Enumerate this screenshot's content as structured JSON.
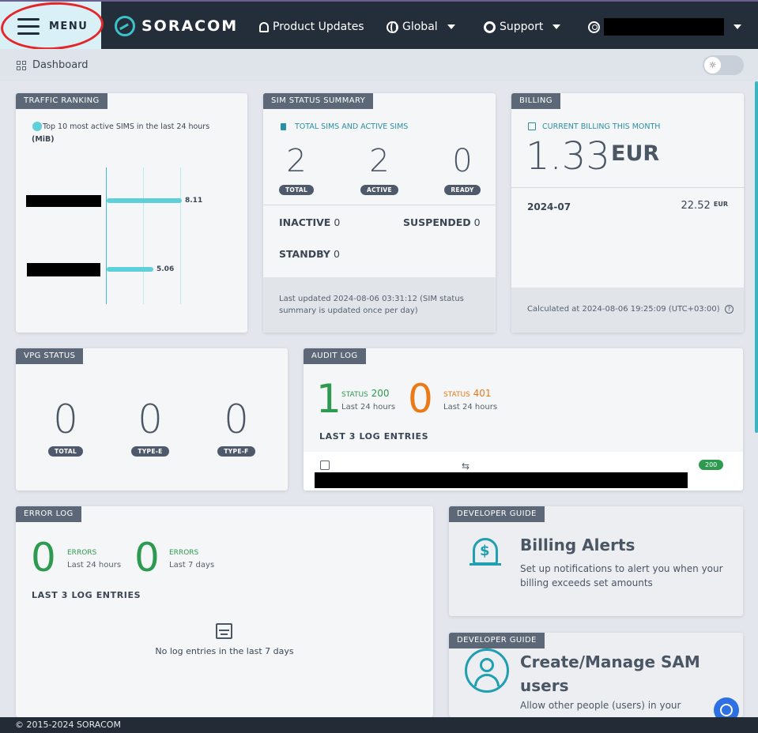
{
  "topbar": {
    "menu_label": "MENU",
    "logo_text": "SORACOM",
    "product_updates": "Product Updates",
    "region": "Global",
    "support": "Support"
  },
  "subbar": {
    "dashboard_label": "Dashboard"
  },
  "traffic": {
    "tab": "TRAFFIC RANKING",
    "legend": "Top 10 most active SIMS in the last 24 hours",
    "unit": "(MiB)",
    "bars": [
      {
        "value": 8.11,
        "label": "8.11"
      },
      {
        "value": 5.06,
        "label": "5.06"
      }
    ]
  },
  "sim": {
    "tab": "SIM STATUS SUMMARY",
    "subtitle": "TOTAL SIMS AND ACTIVE SIMS",
    "counts": [
      {
        "value": "2",
        "label": "TOTAL"
      },
      {
        "value": "2",
        "label": "ACTIVE"
      },
      {
        "value": "0",
        "label": "READY"
      }
    ],
    "inactive_label": "INACTIVE",
    "inactive_value": "0",
    "suspended_label": "SUSPENDED",
    "suspended_value": "0",
    "standby_label": "STANDBY",
    "standby_value": "0",
    "updated_line1": "Last updated 2024-08-06 03:31:12 (SIM status",
    "updated_line2": "summary is updated once per day)"
  },
  "billing": {
    "tab": "BILLING",
    "subtitle": "CURRENT BILLING THIS MONTH",
    "amount": "1.33",
    "currency": "EUR",
    "period": "2024-07",
    "period_amount": "22.52",
    "period_currency": "EUR",
    "calculated": "Calculated at 2024-08-06 19:25:09 (UTC+03:00)"
  },
  "vpg": {
    "tab": "VPG STATUS",
    "counts": [
      {
        "value": "0",
        "label": "TOTAL"
      },
      {
        "value": "0",
        "label": "TYPE-E"
      },
      {
        "value": "0",
        "label": "TYPE-F"
      }
    ]
  },
  "audit": {
    "tab": "AUDIT LOG",
    "ok_value": "1",
    "ok_status": "STATUS",
    "ok_code": "200",
    "ok_period": "Last 24 hours",
    "err_value": "0",
    "err_status": "STATUS",
    "err_code": "401",
    "err_period": "Last 24 hours",
    "entries_title": "LAST 3 LOG ENTRIES",
    "row_badge": "200"
  },
  "errorlog": {
    "tab": "ERROR LOG",
    "v1": "0",
    "l1": "ERRORS",
    "p1": "Last 24 hours",
    "v2": "0",
    "l2": "ERRORS",
    "p2": "Last 7 days",
    "entries_title": "LAST 3 LOG ENTRIES",
    "empty": "No log entries in the last 7 days"
  },
  "guide1": {
    "tab": "DEVELOPER GUIDE",
    "title": "Billing Alerts",
    "line1": "Set up notifications to alert you when your",
    "line2": "billing exceeds set amounts"
  },
  "guide2": {
    "tab": "DEVELOPER GUIDE",
    "title1": "Create/Manage SAM",
    "title2": "users",
    "line1": "Allow other people (users) in your"
  },
  "footer": {
    "copyright": "© 2015-2024 SORACOM"
  },
  "colors": {
    "accent": "#3dc2c9",
    "green": "#2e9a50",
    "orange": "#ea7a17",
    "dark": "#242e3b"
  }
}
